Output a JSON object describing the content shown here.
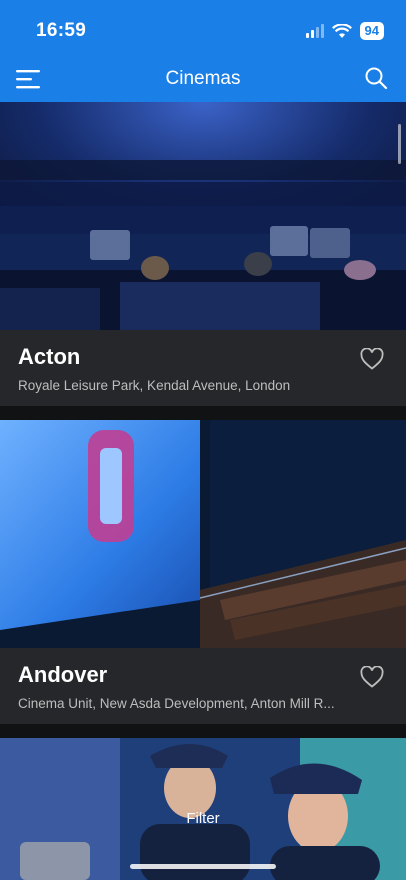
{
  "status": {
    "time": "16:59",
    "battery": "94"
  },
  "header": {
    "title": "Cinemas"
  },
  "cinemas": [
    {
      "name": "Acton",
      "address": "Royale Leisure Park, Kendal Avenue, London"
    },
    {
      "name": "Andover",
      "address": "Cinema Unit, New Asda Development, Anton Mill R..."
    }
  ],
  "filter": {
    "label": "Filter"
  },
  "colors": {
    "brand": "#1a7fe6",
    "card_bg": "#26272b",
    "page_bg": "#111214"
  },
  "icons": [
    "menu-icon",
    "search-icon",
    "heart-outline-icon",
    "wifi-icon",
    "signal-icon",
    "battery-icon"
  ]
}
